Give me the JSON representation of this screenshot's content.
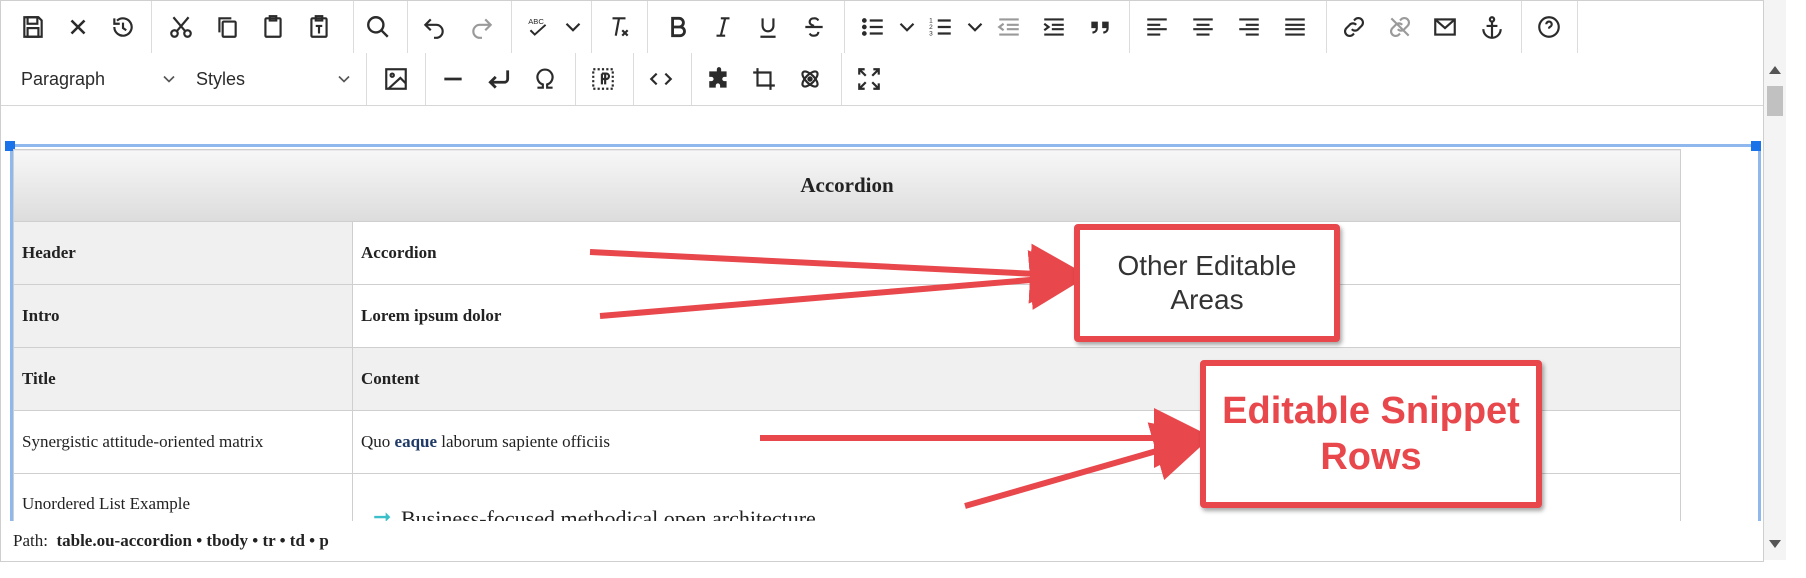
{
  "toolbar": {
    "row1_icons": [
      "save-icon",
      "close-icon",
      "restore-icon",
      "cut-icon",
      "copy-icon",
      "paste-icon",
      "paste-text-icon",
      "search-icon",
      "undo-icon",
      "redo-icon",
      "spellcheck-icon",
      "chevron-down-icon",
      "clear-format-icon",
      "bold-icon",
      "italic-icon",
      "underline-icon",
      "strikethrough-icon",
      "bullet-list-icon",
      "chevron-down-icon",
      "numbered-list-icon",
      "chevron-down-icon",
      "outdent-icon",
      "indent-icon",
      "blockquote-icon",
      "align-left-icon",
      "align-center-icon",
      "align-right-icon",
      "justify-icon",
      "link-icon",
      "unlink-icon",
      "email-icon",
      "anchor-icon",
      "help-icon"
    ],
    "format_select": "Paragraph",
    "styles_select": "Styles",
    "row2_icons": [
      "image-icon",
      "horizontal-rule-icon",
      "line-break-icon",
      "special-char-icon",
      "show-blocks-icon",
      "source-code-icon",
      "plugin-icon",
      "crop-icon",
      "snippet-icon",
      "fullscreen-icon"
    ]
  },
  "table": {
    "title": "Accordion",
    "rows": [
      {
        "label": "Header",
        "value": "Accordion"
      },
      {
        "label": "Intro",
        "value": "Lorem ipsum dolor"
      }
    ],
    "columns": {
      "title": "Title",
      "content": "Content"
    },
    "snippet_rows": [
      {
        "title": "Synergistic attitude-oriented matrix",
        "content_pre": "Quo ",
        "content_link": "eaque",
        "content_post": " laborum sapiente officiis"
      },
      {
        "title": "Unordered List Example",
        "content": "Business-focused methodical open architecture"
      }
    ]
  },
  "callouts": {
    "other": "Other Editable Areas",
    "snippet": "Editable Snippet Rows"
  },
  "status": {
    "path_label": "Path:",
    "path": "table.ou-accordion • tbody • tr • td • p"
  },
  "colors": {
    "accent": "#e8474c",
    "selection": "#8fb8ef",
    "bullet": "#3bbfc9"
  }
}
